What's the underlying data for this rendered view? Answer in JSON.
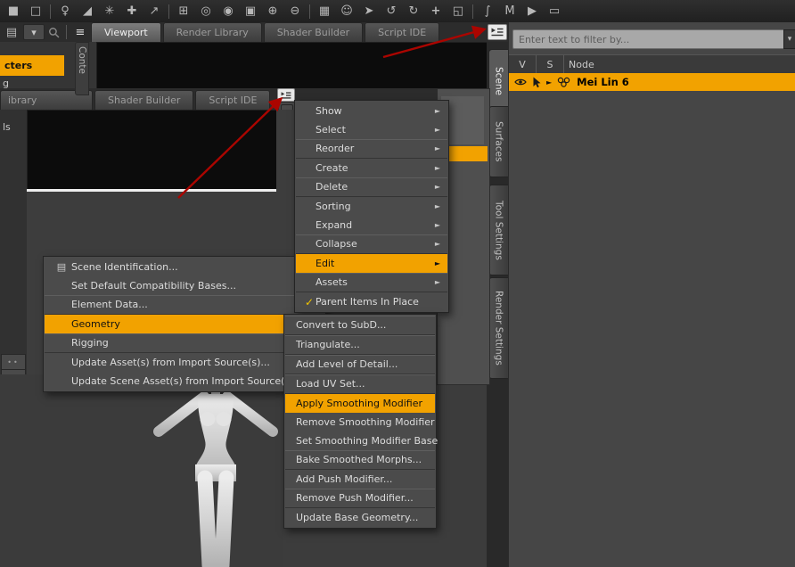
{
  "colors": {
    "accent": "#f2a200",
    "arrow": "#ab0500"
  },
  "icons": {
    "submenu_arrow": "►",
    "check": "✓",
    "expand_arrow": "►",
    "filter_menu": "▾",
    "view_mode": "▾",
    "content_stack": "▤",
    "pane_list": "≡",
    "scene_id": "▤"
  },
  "toolbar": {
    "icons": [
      {
        "name": "cube-solid",
        "glyph": "■"
      },
      {
        "name": "cube-wire",
        "glyph": "□"
      },
      {
        "name": "figure",
        "glyph": "♀"
      },
      {
        "name": "shear-tool",
        "glyph": "◢"
      },
      {
        "name": "star-tool",
        "glyph": "✳"
      },
      {
        "name": "axes-tool",
        "glyph": "✚"
      },
      {
        "name": "export",
        "glyph": "↗"
      },
      {
        "name": "cube-add",
        "glyph": "⊞"
      },
      {
        "name": "target",
        "glyph": "◎"
      },
      {
        "name": "record",
        "glyph": "◉"
      },
      {
        "name": "cube-node",
        "glyph": "▣"
      },
      {
        "name": "node-plus",
        "glyph": "⊕"
      },
      {
        "name": "node-minus",
        "glyph": "⊖"
      },
      {
        "name": "grid",
        "glyph": "▦"
      },
      {
        "name": "smiley",
        "glyph": "☺"
      },
      {
        "name": "cursor",
        "glyph": "➤"
      },
      {
        "name": "rotate-ccw",
        "glyph": "↺"
      },
      {
        "name": "rotate-cw",
        "glyph": "↻"
      },
      {
        "name": "move",
        "glyph": "+"
      },
      {
        "name": "scale",
        "glyph": "◱"
      },
      {
        "name": "spline",
        "glyph": "∫"
      },
      {
        "name": "morph",
        "glyph": "M"
      },
      {
        "name": "play",
        "glyph": "▶"
      },
      {
        "name": "frame",
        "glyph": "▭"
      }
    ]
  },
  "viewport_tabs": {
    "tabs": [
      {
        "label": "Viewport",
        "active": true
      },
      {
        "label": "Render Library",
        "active": false
      },
      {
        "label": "Shader Builder",
        "active": false
      },
      {
        "label": "Script IDE",
        "active": false
      }
    ]
  },
  "floating_pane": {
    "tabs": [
      {
        "label": "ibrary"
      },
      {
        "label": "Shader Builder"
      },
      {
        "label": "Script IDE"
      }
    ]
  },
  "left_pane": {
    "vertical_label": "Conte",
    "selected_item": "cters",
    "fragment_1": "g",
    "fragment_2": "ls"
  },
  "scene_panel": {
    "filter_placeholder": "Enter text to filter by...",
    "columns": {
      "v": "V",
      "s": "S",
      "node": "Node"
    },
    "selected_node": "Mei Lin 6"
  },
  "side_tabs": [
    {
      "label": "Scene",
      "active": true
    },
    {
      "label": "Surfaces",
      "active": false
    },
    {
      "label": "Tool Settings",
      "active": false
    },
    {
      "label": "Render Settings",
      "active": false
    }
  ],
  "menus": {
    "pane_options": {
      "items": [
        {
          "label": "Show",
          "submenu": true
        },
        {
          "label": "Select",
          "submenu": true
        },
        {
          "label": "Reorder",
          "submenu": true,
          "separator_after": true
        },
        {
          "label": "Create",
          "submenu": true
        },
        {
          "label": "Delete",
          "submenu": true,
          "separator_after": true
        },
        {
          "label": "Sorting",
          "submenu": true
        },
        {
          "label": "Expand",
          "submenu": true
        },
        {
          "label": "Collapse",
          "submenu": true,
          "separator_after": true
        },
        {
          "label": "Edit",
          "submenu": true,
          "highlighted": true
        },
        {
          "label": "Assets",
          "submenu": true,
          "separator_after": true
        },
        {
          "label": "Parent Items In Place",
          "checked": true
        }
      ]
    },
    "edit_submenu": {
      "items": [
        {
          "label": "Scene Identification...",
          "icon": "scene-identification"
        },
        {
          "label": "Set Default Compatibility Bases..."
        },
        {
          "label": "Element Data...",
          "separator_after": true
        },
        {
          "label": "Geometry",
          "submenu": true,
          "highlighted": true
        },
        {
          "label": "Rigging",
          "submenu": true,
          "separator_after": true
        },
        {
          "label": "Update Asset(s) from Import Source(s)..."
        },
        {
          "label": "Update Scene Asset(s) from Import Source(s)..."
        }
      ]
    },
    "geometry_submenu": {
      "items": [
        {
          "label": "Convert to SubD...",
          "separator_after": true
        },
        {
          "label": "Triangulate...",
          "separator_after": true
        },
        {
          "label": "Add Level of Detail...",
          "separator_after": true
        },
        {
          "label": "Load UV Set...",
          "separator_after": true
        },
        {
          "label": "Apply Smoothing Modifier",
          "highlighted": true
        },
        {
          "label": "Remove Smoothing Modifier"
        },
        {
          "label": "Set Smoothing Modifier Base"
        },
        {
          "label": "Bake Smoothed Morphs...",
          "separator_after": true
        },
        {
          "label": "Add Push Modifier..."
        },
        {
          "label": "Remove Push Modifier...",
          "separator_after": true
        },
        {
          "label": "Update Base Geometry..."
        }
      ]
    }
  }
}
